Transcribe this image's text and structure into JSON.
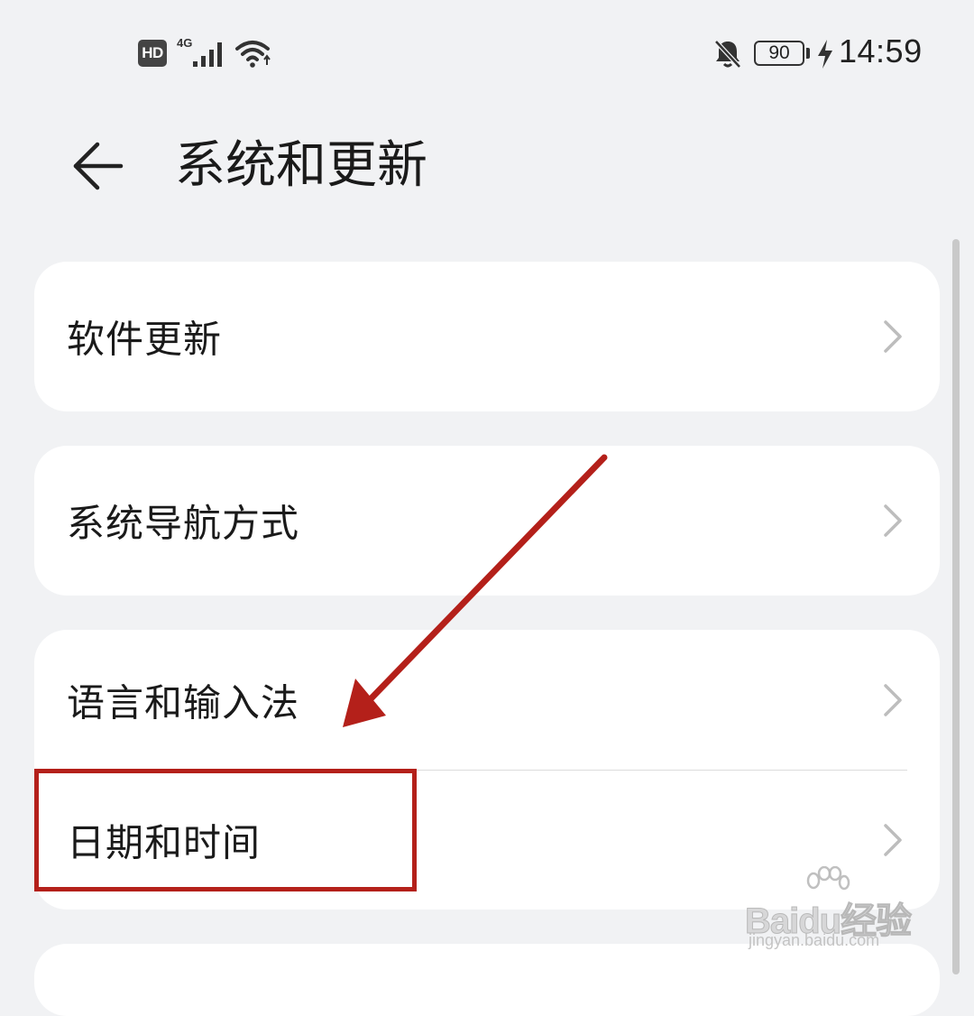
{
  "status_bar": {
    "hd_label": "HD",
    "network_label": "4G",
    "battery_level": "90",
    "time": "14:59",
    "icons": [
      "signal-icon",
      "wifi-icon",
      "bell-muted-icon",
      "charging-icon"
    ]
  },
  "header": {
    "back_icon": "arrow-left-icon",
    "title": "系统和更新"
  },
  "menu": {
    "items": [
      {
        "label": "软件更新"
      },
      {
        "label": "系统导航方式"
      },
      {
        "label": "语言和输入法"
      },
      {
        "label": "日期和时间"
      }
    ],
    "chevron_icon": "chevron-right-icon"
  },
  "annotation": {
    "color": "#b4201a",
    "highlighted_item": "日期和时间"
  },
  "watermark": {
    "logo_text": "Baidu经验",
    "url": "jingyan.baidu.com"
  },
  "colors": {
    "background": "#f1f2f4",
    "card": "#ffffff",
    "text": "#1a1a1a",
    "chevron": "#bdbdbd",
    "annotation_red": "#b4201a"
  }
}
